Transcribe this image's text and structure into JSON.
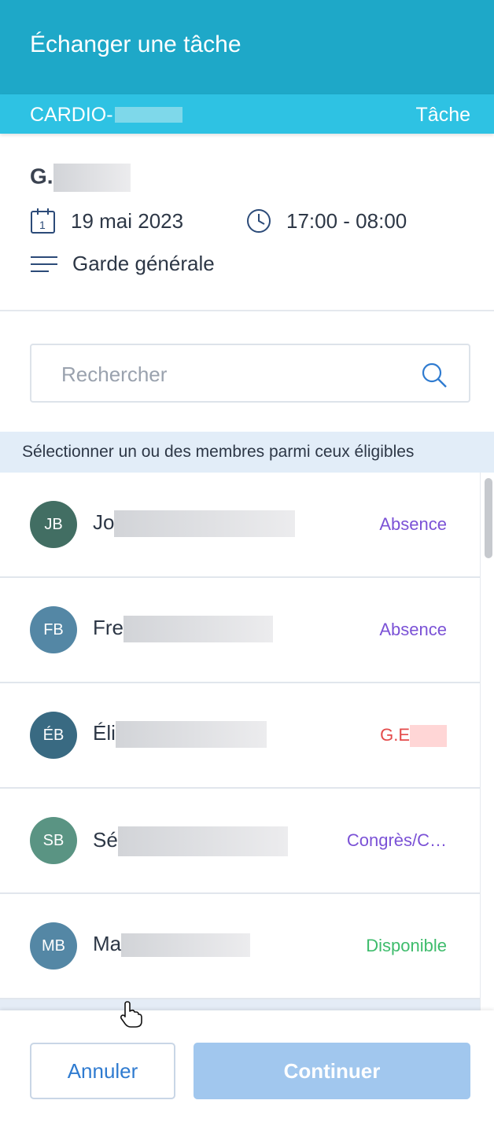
{
  "header": {
    "title": "Échanger une tâche"
  },
  "subbar": {
    "unit": "CARDIO-",
    "label": "Tâche"
  },
  "task": {
    "person": "G.",
    "date": "19 mai 2023",
    "time": "17:00 - 08:00",
    "type": "Garde générale",
    "icons": [
      "calendar-icon",
      "clock-icon",
      "list-icon"
    ],
    "calendar_day": "1"
  },
  "search": {
    "placeholder": "Rechercher",
    "icon": "search-icon"
  },
  "banner": {
    "text": "Sélectionner un ou des membres parmi ceux éligibles"
  },
  "members": [
    {
      "initials": "JB",
      "name": "Jo",
      "status": "Absence",
      "avatar_color": "#426e63",
      "status_color": "#7b52d6"
    },
    {
      "initials": "FB",
      "name": "Fre",
      "status": "Absence",
      "avatar_color": "#5487a5",
      "status_color": "#7b52d6"
    },
    {
      "initials": "ÉB",
      "name": "Éli",
      "status": "G.E",
      "avatar_color": "#396a82",
      "status_color": "#e44b4b"
    },
    {
      "initials": "SB",
      "name": "Sé",
      "status": "Congrès/C…",
      "avatar_color": "#5a9483",
      "status_color": "#7b52d6"
    },
    {
      "initials": "MB",
      "name": "Ma",
      "status": "Disponible",
      "avatar_color": "#5487a5",
      "status_color": "#3ebc6c"
    }
  ],
  "footer": {
    "cancel_label": "Annuler",
    "continue_label": "Continuer"
  },
  "colors": {
    "header": "#1ea8c8",
    "subbar": "#2ec2e3",
    "primary": "#2f7bd0",
    "disabled_button": "#a1c7ee"
  }
}
